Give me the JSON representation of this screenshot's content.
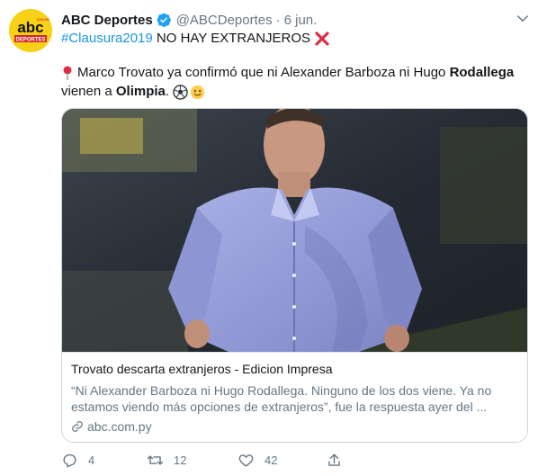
{
  "account": {
    "name": "ABC Deportes",
    "handle": "@ABCDeportes",
    "separator": "·",
    "date": "6 jun.",
    "avatar_text_main": "abc",
    "avatar_text_sub": "DEPORTES",
    "avatar_text_color": "COLOR"
  },
  "tweet": {
    "hashtag": "#Clausura2019",
    "headline": "NO HAY EXTRANJEROS",
    "line_a_prefix": "Marco Trovato ya confirmó que ni Alexander Barboza ni Hugo",
    "line_a_bold": "Rodallega",
    "line_b_prefix": "vienen a",
    "line_b_bold": "Olimpia",
    "line_b_suffix": "."
  },
  "card": {
    "title": "Trovato descarta extranjeros - Edicion Impresa",
    "desc_line1": "“Ni Alexander Barboza ni Hugo Rodallega. Ninguno de los dos viene. Ya no",
    "desc_line2": "estamos viendo más opciones de extranjeros”, fue la respuesta ayer del ...",
    "domain": "abc.com.py"
  },
  "actions": {
    "reply_count": "4",
    "retweet_count": "12",
    "like_count": "42"
  },
  "colors": {
    "link": "#1b95e0",
    "muted": "#657786",
    "verified": "#1da1f2",
    "avatar_bg": "#f7d116",
    "cross": "#dd2e44"
  }
}
